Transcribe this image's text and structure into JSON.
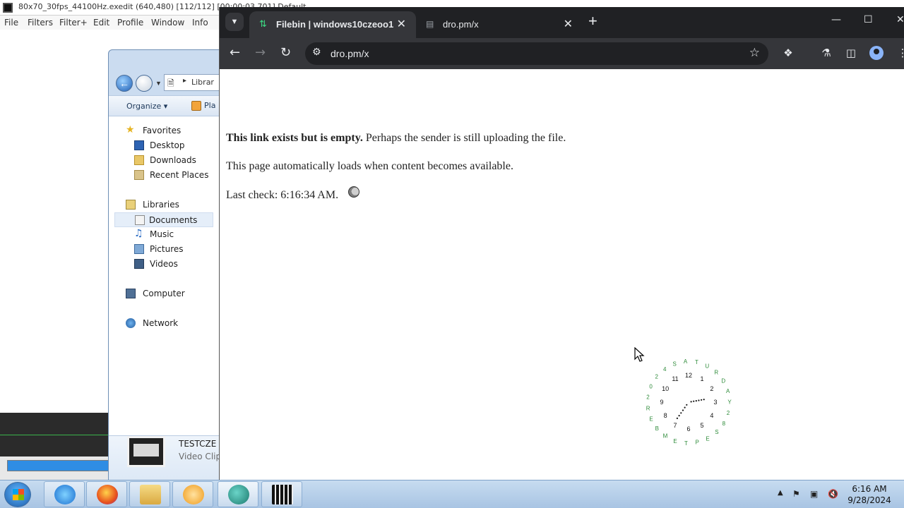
{
  "editor": {
    "title": "80x70_30fps_44100Hz.exedit (640,480)  [112/112] [00:00:03.701] Default",
    "menu": [
      "File",
      "Filters",
      "Filter+",
      "Edit",
      "Profile",
      "Window",
      "Info"
    ],
    "progress_fraction": 1.0
  },
  "explorer": {
    "address_crumb": "Librar",
    "toolbar": {
      "organize": "Organize ▾",
      "play": "Pla"
    },
    "tree": {
      "favorites": "Favorites",
      "desktop": "Desktop",
      "downloads": "Downloads",
      "recent": "Recent Places",
      "libraries": "Libraries",
      "documents": "Documents",
      "music": "Music",
      "pictures": "Pictures",
      "videos": "Videos",
      "computer": "Computer",
      "network": "Network"
    },
    "details": {
      "name": "TESTCZE",
      "type": "Video Clip"
    }
  },
  "browser": {
    "tabs": [
      {
        "title": "Filebin | windows10czeoo1",
        "icon": "filebin-icon"
      },
      {
        "title": "dro.pm/x",
        "icon": "page-icon"
      }
    ],
    "url": "dro.pm/x",
    "content": {
      "bold": "This link exists but is empty.",
      "rest": " Perhaps the sender is still uploading the file.",
      "auto": "This page automatically loads when content becomes available.",
      "last_check": "Last check: 6:16:34 AM."
    }
  },
  "clock": {
    "numbers": [
      "12",
      "1",
      "2",
      "3",
      "4",
      "5",
      "6",
      "7",
      "8",
      "9",
      "10",
      "11"
    ],
    "ring_text": "SATURDAY 28 SEPTEMBER 2024"
  },
  "taskbar": {
    "time": "6:16 AM",
    "date": "9/28/2024"
  }
}
